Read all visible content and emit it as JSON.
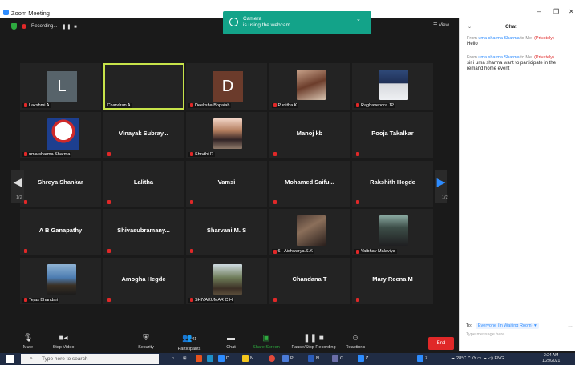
{
  "window": {
    "title": "Zoom Meeting",
    "minimize": "–",
    "maximize": "❐",
    "close": "✕"
  },
  "recording": {
    "label": "Recording...",
    "pause": "❚❚ ■"
  },
  "view": {
    "label": "View",
    "icon": "grid-view-icon"
  },
  "notice": {
    "line1": "Camera",
    "line2": "is using the webcam",
    "chevron": "⌄"
  },
  "pagination": {
    "left_page": "1/2",
    "right_page": "1/2"
  },
  "participants": [
    {
      "name": "Lakshmi A",
      "type": "letter",
      "letter": "L"
    },
    {
      "name": "Chandran A",
      "type": "blank",
      "active": true
    },
    {
      "name": "Deeksha Bopaiah",
      "type": "letter",
      "letter": "D"
    },
    {
      "name": "Punitha K",
      "type": "photo",
      "photo": "p1"
    },
    {
      "name": "Raghavendra JP",
      "type": "photo",
      "photo": "p2"
    },
    {
      "name": "uma sharma Sharma",
      "type": "photo",
      "photo": "p3"
    },
    {
      "name": "Vinayak Subray...",
      "type": "big"
    },
    {
      "name": "Shruthi R",
      "type": "photo",
      "photo": "p4"
    },
    {
      "name": "Manoj kb",
      "type": "big"
    },
    {
      "name": "Pooja Takalkar",
      "type": "big"
    },
    {
      "name": "Shreya Shankar",
      "type": "big"
    },
    {
      "name": "Lalitha",
      "type": "big"
    },
    {
      "name": "Vamsi",
      "type": "big"
    },
    {
      "name": "Mohamed Saifu...",
      "type": "big"
    },
    {
      "name": "Rakshith Hegde",
      "type": "big"
    },
    {
      "name": "A B Ganapathy",
      "type": "big"
    },
    {
      "name": "Shivasubramany...",
      "type": "big"
    },
    {
      "name": "Sharvani M. S",
      "type": "big"
    },
    {
      "name": "6 - Aishwarya.S.K",
      "type": "photo",
      "photo": "p5"
    },
    {
      "name": "Vaibhav Malaviya",
      "type": "photo",
      "photo": "p6"
    },
    {
      "name": "Tejas Bhandari",
      "type": "photo",
      "photo": "p7"
    },
    {
      "name": "Amogha Hegde",
      "type": "big"
    },
    {
      "name": "SHIVAKUMAR C H",
      "type": "photo",
      "photo": "p8"
    },
    {
      "name": "Chandana T",
      "type": "big"
    },
    {
      "name": "Mary Reena M",
      "type": "big"
    }
  ],
  "toolbar": {
    "mute": "Mute",
    "stop_video": "Stop Video",
    "security": "Security",
    "participants": "Participants",
    "participants_count": "41",
    "chat": "Chat",
    "share_screen": "Share Screen",
    "recording": "Pause/Stop Recording",
    "reactions": "Reactions",
    "end": "End"
  },
  "chat": {
    "title": "Chat",
    "messages": [
      {
        "from_prefix": "From",
        "sender": "uma sharma Sharma",
        "to": "to Me:",
        "privacy": "(Privately)",
        "text": "Hello"
      },
      {
        "from_prefix": "From",
        "sender": "uma sharma Sharma",
        "to": "to Me:",
        "privacy": "(Privately)",
        "text": "sir i uma sharma want to participate in the remand home event"
      }
    ],
    "to_label": "To:",
    "to_value": "Everyone (in Waiting Room) ▾",
    "input_placeholder": "Type message here..."
  },
  "taskbar": {
    "search_placeholder": "Type here to search",
    "apps": [
      "D...",
      "N...",
      "P...",
      "N...",
      "C...",
      "Z...",
      "Z..."
    ],
    "weather": "28°C",
    "lang": "ENG",
    "time": "2:24 AM",
    "date": "1/29/2021"
  }
}
